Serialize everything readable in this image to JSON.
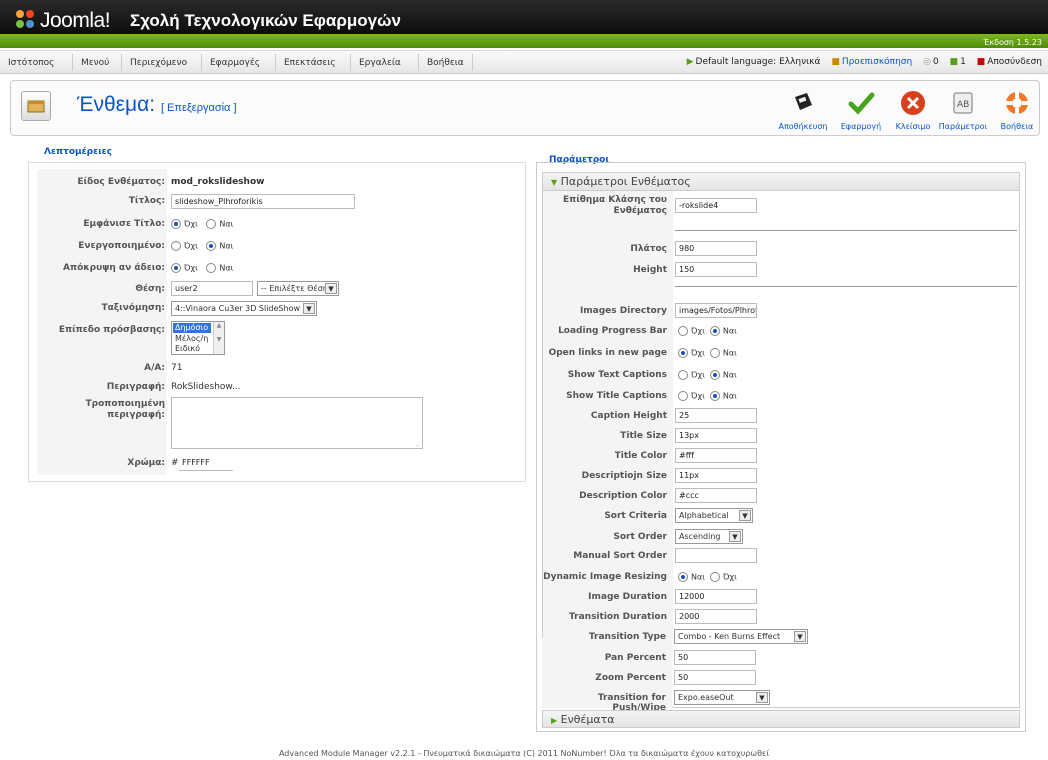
{
  "header": {
    "brand": "Joomla!",
    "site_name": "Σχολή Τεχνολογικών Εφαρμογών",
    "version": "Έκδοση 1.5.23"
  },
  "menu": {
    "items": [
      "Ιστότοπος",
      "Μενού",
      "Περιεχόμενο",
      "Εφαρμογές",
      "Επεκτάσεις",
      "Εργαλεία",
      "Βοήθεια"
    ]
  },
  "status": {
    "default_language": "Default language: Ελληνικά",
    "preview": "Προεπισκόπηση",
    "messages": "0",
    "users": "1",
    "logout": "Αποσύνδεση"
  },
  "page": {
    "title": "Ένθεμα:",
    "subtitle": "[ Επεξεργασία ]"
  },
  "toolbar": {
    "save": "Αποθήκευση",
    "apply": "Εφαρμογή",
    "close": "Κλείσιμο",
    "params": "Παράμετροι",
    "help": "Βοήθεια"
  },
  "details": {
    "legend": "Λεπτομέρειες",
    "type_label": "Είδος Ενθέματος:",
    "type_value": "mod_rokslideshow",
    "title_label": "Τίτλος:",
    "title_value": "slideshow_Plhroforikis",
    "show_title_label": "Εμφάνισε Τίτλο:",
    "enabled_label": "Ενεργοποιημένο:",
    "hide_empty_label": "Απόκρυψη αν άδειο:",
    "no": "Όχι",
    "yes": "Ναι",
    "position_label": "Θέση:",
    "position_value": "user2",
    "position_select": "-- Επιλέξτε Θέση --",
    "order_label": "Ταξινόμηση:",
    "order_value": "4::Vinaora Cu3er 3D SlideShow",
    "access_label": "Επίπεδο πρόσβασης:",
    "access_options": [
      "Δημόσιο",
      "Μέλος/η",
      "Ειδικό"
    ],
    "id_label": "Α/Α:",
    "id_value": "71",
    "desc_label": "Περιγραφή:",
    "desc_value": "RokSlideshow...",
    "custom_desc_label1": "Τροποποιημένη",
    "custom_desc_label2": "περιγραφή:",
    "color_label": "Χρώμα:",
    "color_hash": "#",
    "color_value": "FFFFFF"
  },
  "params": {
    "legend": "Παράμετροι",
    "section": "Παράμετροι Ενθέματος",
    "suffix_label1": "Επίθημα Κλάσης του",
    "suffix_label2": "Ενθέματος",
    "suffix_value": "-rokslide4",
    "width_label": "Πλάτος",
    "width_value": "980",
    "height_label": "Height",
    "height_value": "150",
    "images_dir_label": "Images Directory",
    "images_dir_value": "images/Fotos/Plhrofc",
    "loading_label": "Loading Progress Bar",
    "open_links_label": "Open links in new page",
    "show_text_label": "Show Text Captions",
    "show_title_label": "Show Title Captions",
    "caption_height_label": "Caption Height",
    "caption_height_value": "25",
    "title_size_label": "Title Size",
    "title_size_value": "13px",
    "title_color_label": "Title Color",
    "title_color_value": "#fff",
    "desc_size_label": "Descriptiojn Size",
    "desc_size_value": "11px",
    "desc_color_label": "Description Color",
    "desc_color_value": "#ccc",
    "sort_criteria_label": "Sort Criteria",
    "sort_criteria_value": "Alphabetical",
    "sort_order_label": "Sort Order",
    "sort_order_value": "Ascending",
    "manual_sort_label": "Manual Sort Order",
    "manual_sort_value": "",
    "dynamic_label": "Dynamic Image Resizing",
    "image_duration_label": "Image Duration",
    "image_duration_value": "12000",
    "transition_duration_label": "Transition Duration",
    "transition_duration_value": "2000",
    "transition_type_label": "Transition Type",
    "transition_type_value": "Combo - Ken Burns Effect",
    "pan_label": "Pan Percent",
    "pan_value": "50",
    "zoom_label": "Zoom Percent",
    "zoom_value": "50",
    "push_label": "Transition for Push/Wipe",
    "push_value": "Expo.easeOut",
    "no": "Όχι",
    "yes": "Ναι",
    "modules_section": "Ενθέματα"
  },
  "footer": {
    "text": "Advanced Module Manager v2.2.1 - Πνευματικά δικαιώματα (C) 2011 NoNumber! Όλα τα δικαιώματα έχουν κατοχυρωθεί"
  }
}
